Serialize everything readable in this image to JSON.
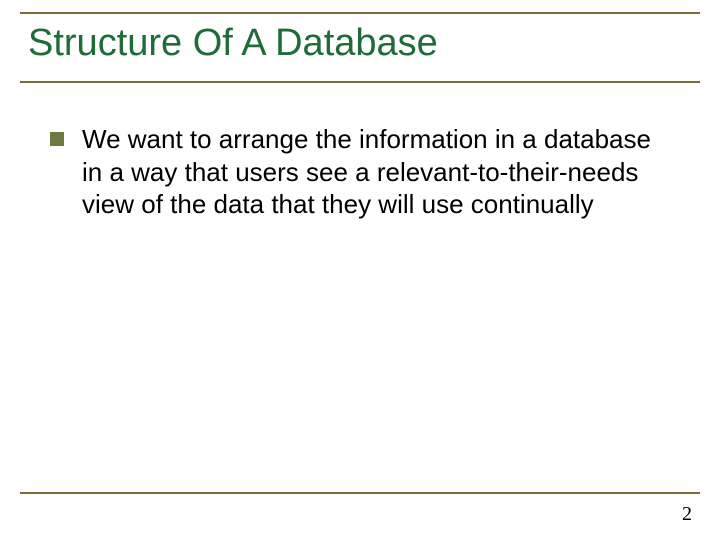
{
  "title": "Structure Of A Database",
  "bullets": [
    {
      "text": "We want to arrange the information in a database in a way that users see a relevant-to-their-needs view of the data that they will use continually"
    }
  ],
  "page_number": "2"
}
